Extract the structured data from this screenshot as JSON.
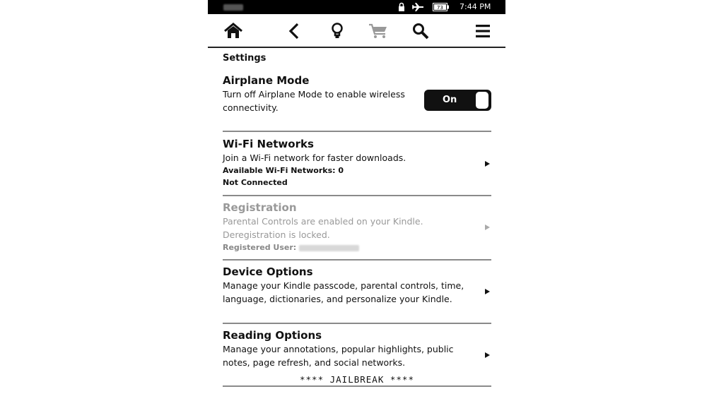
{
  "status_bar": {
    "time": "7:44 PM",
    "battery_label": "73",
    "icons": [
      "lock-icon",
      "airplane-icon",
      "battery-icon"
    ]
  },
  "toolbar": {
    "icons": [
      "home-icon",
      "back-icon",
      "lightbulb-icon",
      "cart-icon",
      "search-icon",
      "menu-icon"
    ]
  },
  "page": {
    "title": "Settings"
  },
  "airplane": {
    "title": "Airplane Mode",
    "desc_line1": "Turn off Airplane Mode to enable wireless",
    "desc_line2": "connectivity.",
    "toggle_label": "On"
  },
  "wifi": {
    "title": "Wi-Fi Networks",
    "desc": "Join a Wi-Fi network for faster downloads.",
    "available": "Available Wi-Fi Networks: 0",
    "status": "Not Connected"
  },
  "registration": {
    "title": "Registration",
    "desc_line1": "Parental Controls are enabled on your Kindle.",
    "desc_line2": "Deregistration is locked.",
    "user_label": "Registered User:"
  },
  "device": {
    "title": "Device Options",
    "desc_line1": "Manage your Kindle passcode, parental controls, time,",
    "desc_line2": "language, dictionaries, and personalize your Kindle."
  },
  "reading": {
    "title": "Reading Options",
    "desc_line1": "Manage your annotations, popular highlights, public",
    "desc_line2": "notes, page refresh, and social networks."
  },
  "footer": {
    "jailbreak": "**** JAILBREAK ****"
  }
}
